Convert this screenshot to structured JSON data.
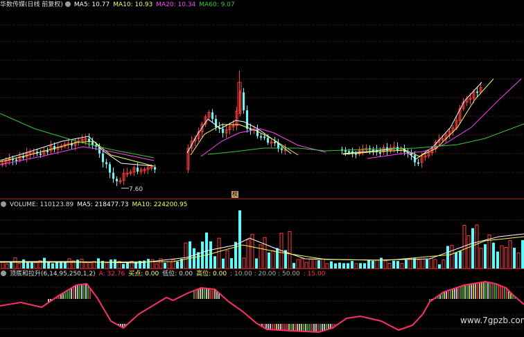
{
  "stock": {
    "title": "华数传媒(日线 前复权)",
    "ma5": "MA5: 10.77",
    "ma10": "MA10: 10.93",
    "ma20": "MA20: 10.34",
    "ma60": "MA60: 9.07",
    "low_label": "7.60",
    "event_badge": "权"
  },
  "volume": {
    "label": "VOLUME: 110123.89",
    "ma5": "MA5: 218477.73",
    "ma10": "MA10: 224200.95"
  },
  "indicator": {
    "name": "顶底和拉升(6,14,95,250,1,2)",
    "a": "A: 32.76",
    "buy_label": "买点: 0.00",
    "low_label": "低位: 0.00",
    "high_label": "高位: 0.00",
    "levels": ": 10.00 : 20.00 : 50.00",
    "top_level": ": 15.00"
  },
  "watermark": "www.7gpzb.com",
  "colors": {
    "up": "#ff3b3b",
    "down": "#54ffff",
    "ma5": "#ffffff",
    "ma10": "#ffff55",
    "ma20": "#ff44ff",
    "ma60": "#33cc33",
    "indicator_line": "#ff2d6f"
  }
}
